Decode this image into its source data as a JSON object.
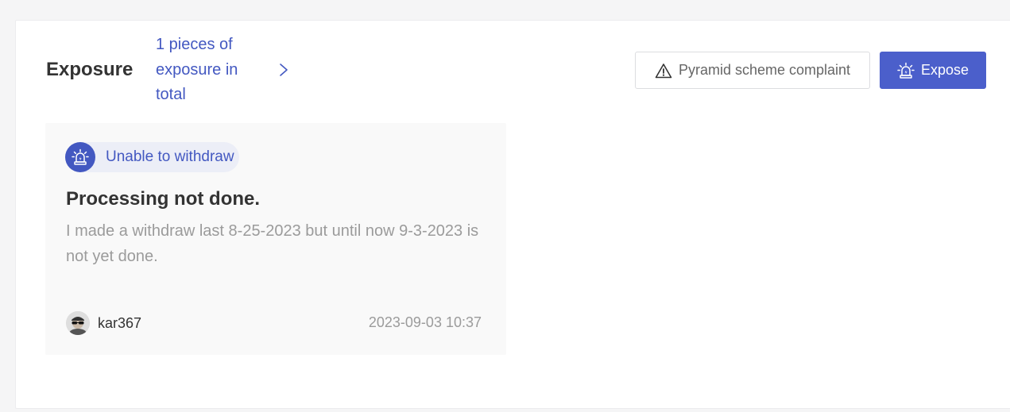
{
  "header": {
    "title": "Exposure",
    "count_link": "1 pieces of exposure in total",
    "complaint_button": "Pyramid scheme complaint",
    "expose_button": "Expose"
  },
  "exposure_card": {
    "tag": "Unable to withdraw",
    "title": "Processing not done.",
    "body": "I made a withdraw last 8-25-2023 but until now 9-3-2023 is not yet done.",
    "author": "kar367",
    "timestamp": "2023-09-03 10:37"
  },
  "icons": {
    "chevron": "chevron-right-icon",
    "warning": "warning-triangle-icon",
    "alarm": "alarm-light-icon",
    "avatar": "user-avatar"
  },
  "colors": {
    "accent": "#4b5fcb",
    "link": "#4358c1",
    "tag_bg": "#eceef7",
    "card_bg": "#f9f9f9"
  }
}
